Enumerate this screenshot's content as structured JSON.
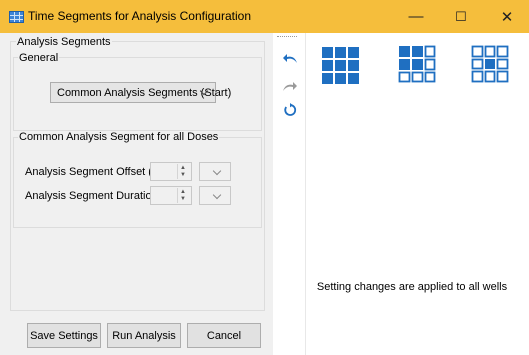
{
  "window": {
    "title": "Time Segments for Analysis Configuration",
    "minimize_glyph": "—",
    "maximize_glyph": "☐",
    "close_glyph": "✕"
  },
  "analysis_segments": {
    "title": "Analysis Segments",
    "general": {
      "title": "General",
      "mode_selected": "Common Analysis Segments (Start)"
    },
    "common": {
      "title": "Common Analysis Segment for all Doses",
      "offset_label": "Analysis Segment Offset (Start)",
      "offset_value": "",
      "offset_unit": "",
      "duration_label": "Analysis Segment Duration",
      "duration_value": "",
      "duration_unit": ""
    }
  },
  "buttons": {
    "save": "Save Settings",
    "run": "Run Analysis",
    "cancel": "Cancel"
  },
  "toolbar": {
    "icons": [
      "undo-icon",
      "redo-icon",
      "reset-icon"
    ],
    "undo_color": "#1f6fc1",
    "redo_color": "#9a9a9a"
  },
  "layouts": {
    "icons": [
      "layout-filled-grid-icon",
      "layout-mixed-grid-icon",
      "layout-outline-grid-icon"
    ],
    "accent": "#1f6fc1"
  },
  "status": {
    "message": "Setting changes are applied to all wells"
  }
}
